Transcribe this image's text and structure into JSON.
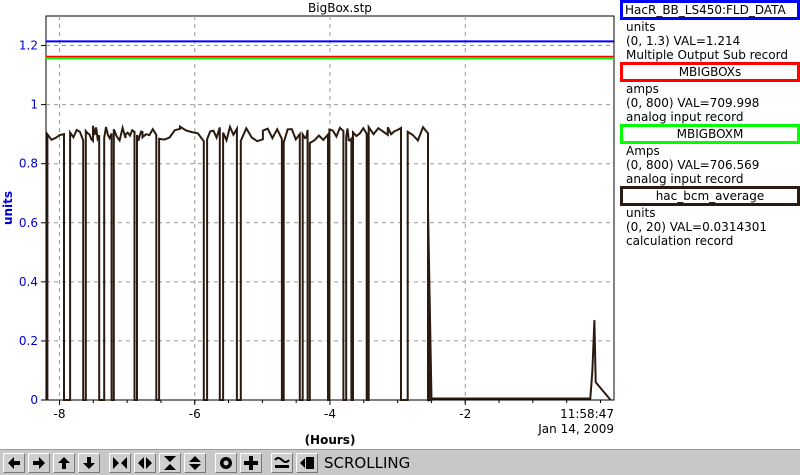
{
  "chart_data": {
    "type": "line",
    "title": "BigBox.stp",
    "ylabel": "units",
    "xlabel": "(Hours)",
    "timestamp_time": "11:58:47",
    "timestamp_date": "Jan 14, 2009",
    "xlim": [
      -8.2,
      0.2
    ],
    "ylim": [
      0,
      1.3
    ],
    "xticks": [
      -8,
      -6,
      -4,
      -2
    ],
    "yticks": [
      0,
      0.2,
      0.4,
      0.6,
      0.8,
      1,
      1.2
    ],
    "ytick_labels": [
      "0",
      "0.2",
      "0.4",
      "0.6",
      "0.8",
      "1",
      "1.2"
    ],
    "xtick_labels": [
      "-8",
      "-6",
      "-4",
      "-2"
    ],
    "grid": true,
    "series": [
      {
        "name": "HacR_BB_LS450:FLD_DATA",
        "color": "#0000ff",
        "constant": 1.214
      },
      {
        "name": "MBIGBOXs",
        "color": "#ff0000",
        "constant": 1.162
      },
      {
        "name": "MBIGBOXM",
        "color": "#00ff00",
        "constant": 1.157
      },
      {
        "name": "hac_bcm_average",
        "color": "#2b1a10",
        "plateau_level": 0.9,
        "drop_level": 0.0,
        "end_of_plateau": -2.55,
        "tail_x": [
          -2.5,
          -0.15,
          -0.12,
          -0.09,
          -0.07
        ],
        "tail_y": [
          0.005,
          0.005,
          0.1,
          0.27,
          0.06
        ]
      }
    ]
  },
  "legend": [
    {
      "name": "HacR_BB_LS450:FLD_DATA",
      "color": "#0000ff",
      "unit": "units",
      "range": "(0, 1.3) VAL=1.214",
      "kind": "Multiple Output Sub record"
    },
    {
      "name": "MBIGBOXs",
      "color": "#ff0000",
      "unit": "amps",
      "range": "(0, 800) VAL=709.998",
      "kind": "analog input record"
    },
    {
      "name": "MBIGBOXM",
      "color": "#00ff00",
      "unit": "Amps",
      "range": "(0, 800) VAL=706.569",
      "kind": "analog input record"
    },
    {
      "name": "hac_bcm_average",
      "color": "#2b1a10",
      "unit": "units",
      "range": "(0, 20) VAL=0.0314301",
      "kind": "calculation record"
    }
  ],
  "toolbar": {
    "status": "SCROLLING",
    "buttons": [
      "arrow-left-icon",
      "arrow-right-icon",
      "arrow-up-icon",
      "arrow-down-icon",
      "zoom-in-x-icon",
      "zoom-out-x-icon",
      "zoom-in-y-icon",
      "zoom-out-y-icon",
      "cursor-icon",
      "crosshair-icon",
      "autoscale-icon",
      "pan-icon"
    ]
  }
}
